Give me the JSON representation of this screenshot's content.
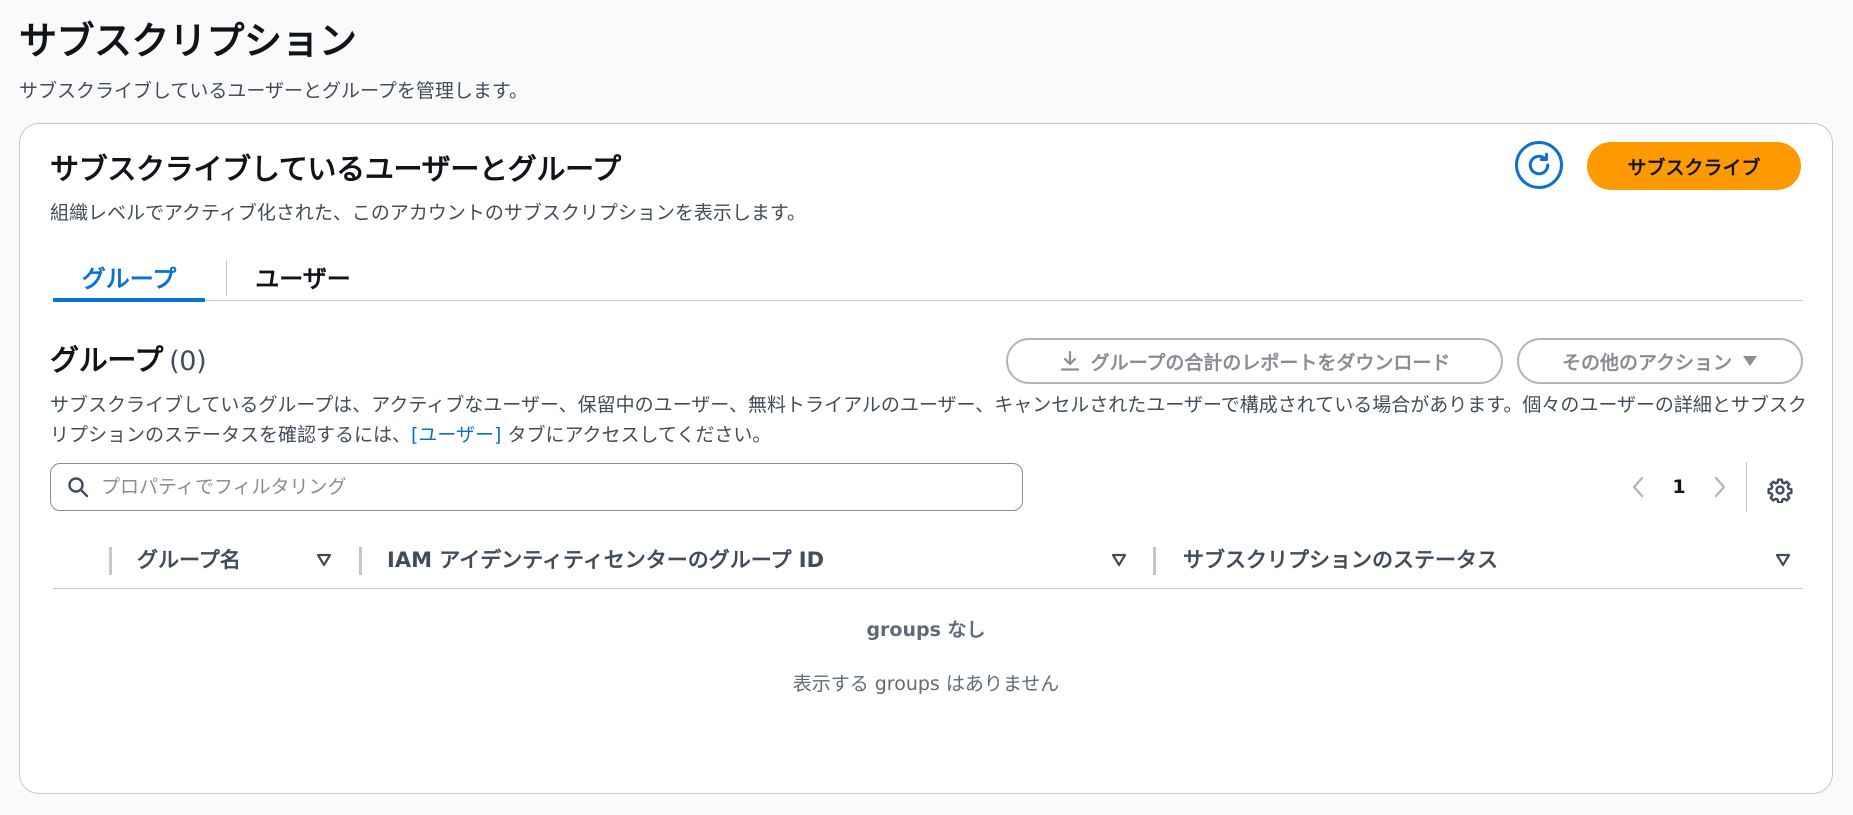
{
  "page": {
    "title": "サブスクリプション",
    "description": "サブスクライブしているユーザーとグループを管理します。"
  },
  "container": {
    "title": "サブスクライブしているユーザーとグループ",
    "description": "組織レベルでアクティブ化された、このアカウントのサブスクリプションを表示します。",
    "subscribe_label": "サブスクライブ"
  },
  "tabs": [
    {
      "label": "グループ",
      "active": true
    },
    {
      "label": "ユーザー",
      "active": false
    }
  ],
  "section": {
    "title": "グループ",
    "count": "(0)",
    "download_label": "グループの合計のレポートをダウンロード",
    "actions_label": "その他のアクション",
    "desc_part1": "サブスクライブしているグループは、アクティブなユーザー、保留中のユーザー、無料トライアルのユーザー、キャンセルされたユーザーで構成されている場合があります。個々のユーザーの詳細とサブスクリプションのステータスを確認するには、",
    "desc_link": "[ユーザー]",
    "desc_part2": " タブにアクセスしてください。"
  },
  "filter": {
    "placeholder": "プロパティでフィルタリング",
    "value": ""
  },
  "pagination": {
    "current_page": "1"
  },
  "table": {
    "columns": [
      "グループ名",
      "IAM アイデンティティセンターのグループ ID",
      "サブスクリプションのステータス"
    ],
    "rows": [],
    "empty_title": "groups なし",
    "empty_description": "表示する groups はありません"
  },
  "colors": {
    "accent": "#0972d3",
    "primary_button": "#ff9900",
    "border": "#c6c6cd"
  },
  "icons": [
    "refresh-icon",
    "download-icon",
    "caret-down-icon",
    "search-icon",
    "chevron-left-icon",
    "chevron-right-icon",
    "gear-icon",
    "sort-icon"
  ]
}
